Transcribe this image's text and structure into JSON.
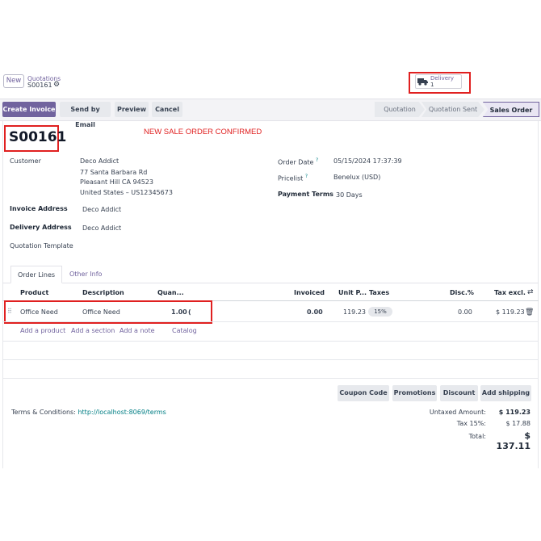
{
  "control_panel": {
    "new_label": "New",
    "breadcrumb": "Quotations",
    "record_name": "S00161",
    "delivery_label": "Delivery",
    "delivery_count": "1"
  },
  "actions": {
    "create_invoice": "Create Invoice",
    "send_email": "Send by Email",
    "preview": "Preview",
    "cancel": "Cancel"
  },
  "statusbar": {
    "stages": [
      "Quotation",
      "Quotation Sent",
      "Sales Order"
    ],
    "active": "Sales Order"
  },
  "form": {
    "order_name": "S00161",
    "confirm_message": "NEW SALE ORDER CONFIRMED",
    "customer_label": "Customer",
    "customer_name": "Deco Addict",
    "address_line1": "77 Santa Barbara Rd",
    "address_line2": "Pleasant Hill CA 94523",
    "address_line3": "United States – US12345673",
    "invoice_address_label": "Invoice Address",
    "invoice_address": "Deco Addict",
    "delivery_address_label": "Delivery Address",
    "delivery_address": "Deco Addict",
    "quotation_template_label": "Quotation Template",
    "order_date_label": "Order Date",
    "order_date": "05/15/2024 17:37:39",
    "pricelist_label": "Pricelist",
    "pricelist": "Benelux (USD)",
    "payment_terms_label": "Payment Terms",
    "payment_terms": "30 Days",
    "help_mark": "?"
  },
  "tabs": {
    "order_lines": "Order Lines",
    "other_info": "Other Info"
  },
  "table": {
    "headers": [
      "Product",
      "Description",
      "Quan...",
      "Invoiced",
      "Unit P...",
      "Taxes",
      "Disc.%",
      "Tax excl."
    ],
    "row": {
      "product": "Office Need",
      "description": "Office Need",
      "quantity": "1.00",
      "invoiced": "0.00",
      "unit_price": "119.23",
      "tax": "15%",
      "discount": "0.00",
      "subtotal": "$ 119.23"
    },
    "add_product": "Add a product",
    "add_section": "Add a section",
    "add_note": "Add a note",
    "catalog": "Catalog"
  },
  "promo_buttons": {
    "coupon": "Coupon Code",
    "promotions": "Promotions",
    "discount": "Discount",
    "shipping": "Add shipping"
  },
  "terms": {
    "label": "Terms & Conditions:",
    "link": "http://localhost:8069/terms"
  },
  "totals": {
    "untaxed_label": "Untaxed Amount:",
    "untaxed": "$ 119.23",
    "tax_label": "Tax 15%:",
    "tax": "$ 17.88",
    "total_label": "Total:",
    "total": "$ 137.11"
  },
  "colors": {
    "accent": "#71639e",
    "link_teal": "#017e84",
    "highlight_red": "#e02020"
  }
}
